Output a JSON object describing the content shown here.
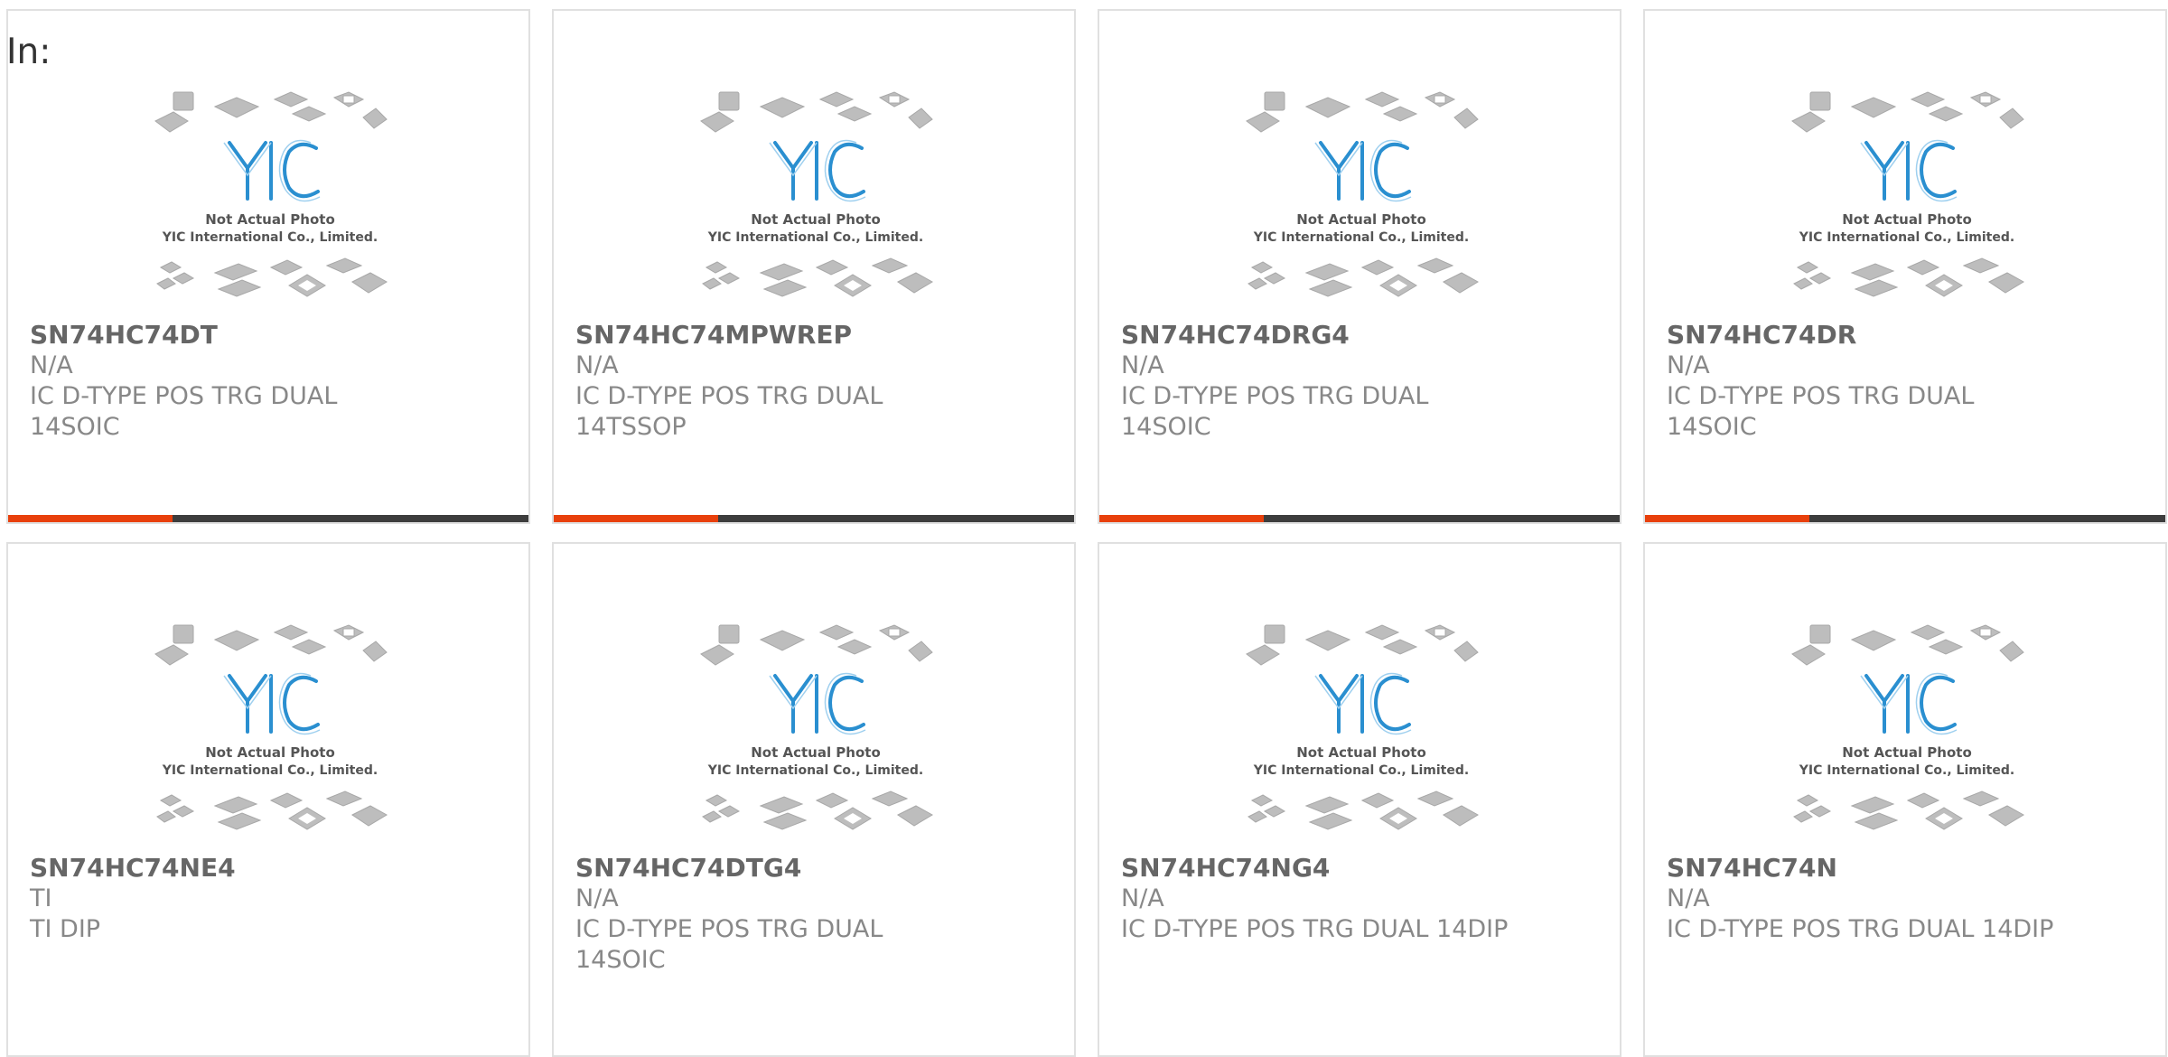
{
  "filter": {
    "label": "In:"
  },
  "placeholder_image": {
    "line1": "Not Actual Photo",
    "line2": "YIC International Co., Limited."
  },
  "products": [
    {
      "part_number": "SN74HC74DT",
      "lines": [
        "N/A",
        "IC D-TYPE POS TRG DUAL",
        "14SOIC"
      ],
      "has_bar": true
    },
    {
      "part_number": "SN74HC74MPWREP",
      "lines": [
        "N/A",
        "IC D-TYPE POS TRG DUAL",
        "14TSSOP"
      ],
      "has_bar": true
    },
    {
      "part_number": "SN74HC74DRG4",
      "lines": [
        "N/A",
        "IC D-TYPE POS TRG DUAL",
        "14SOIC"
      ],
      "has_bar": true
    },
    {
      "part_number": "SN74HC74DR",
      "lines": [
        "N/A",
        "IC D-TYPE POS TRG DUAL",
        "14SOIC"
      ],
      "has_bar": true
    },
    {
      "part_number": "SN74HC74NE4",
      "lines": [
        "TI",
        "TI DIP"
      ],
      "has_bar": false
    },
    {
      "part_number": "SN74HC74DTG4",
      "lines": [
        "N/A",
        "IC D-TYPE POS TRG DUAL",
        "14SOIC"
      ],
      "has_bar": false
    },
    {
      "part_number": "SN74HC74NG4",
      "lines": [
        "N/A",
        "IC D-TYPE POS TRG DUAL 14DIP"
      ],
      "has_bar": false
    },
    {
      "part_number": "SN74HC74N",
      "lines": [
        "N/A",
        "IC D-TYPE POS TRG DUAL 14DIP"
      ],
      "has_bar": false
    }
  ],
  "colors": {
    "accent": "#e8400c",
    "bar": "#3d3d3d",
    "logo_blue": "#2a8fd0"
  },
  "icons": {
    "product_image": "yic-placeholder-icon"
  }
}
